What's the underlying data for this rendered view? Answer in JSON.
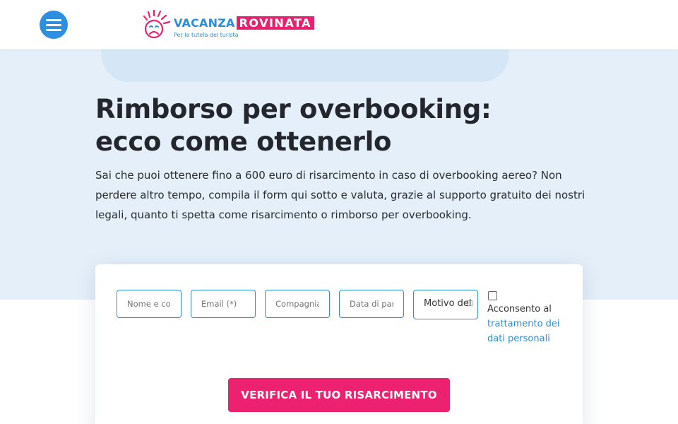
{
  "header": {
    "menu_icon": "hamburger-menu-icon",
    "logo": {
      "word_left": "VACANZA",
      "word_right": "ROVINATA",
      "tagline": "Per la tutela del turista",
      "colors": {
        "blue": "#2a8fd6",
        "pink": "#e8206f"
      }
    }
  },
  "hero": {
    "title": "Rimborso per overbooking: ecco come ottenerlo",
    "lead": "Sai che puoi ottenere fino a 600 euro di risarcimento in caso di overbooking aereo? Non perdere altro tempo, compila il form qui sotto e valuta, grazie al supporto gratuito dei nostri legali, quanto ti spetta come risarcimento o rimborso per overbooking."
  },
  "form": {
    "fields": [
      {
        "placeholder": "Nome e cognome"
      },
      {
        "placeholder": "Email (*)"
      },
      {
        "placeholder": "Compagnia"
      },
      {
        "placeholder": "Data di partenza"
      },
      {
        "placeholder": "Motivo del"
      }
    ],
    "consent": {
      "text": "Acconsento al",
      "link_text": "trattamento dei dati personali"
    },
    "submit_label": "VERIFICA IL TUO RISARCIMENTO"
  },
  "colors": {
    "accent_pink": "#ec216f",
    "brand_blue": "#2a8fd6",
    "menu_blue": "#2e8fe0",
    "hero_bg": "#e4eff9"
  }
}
